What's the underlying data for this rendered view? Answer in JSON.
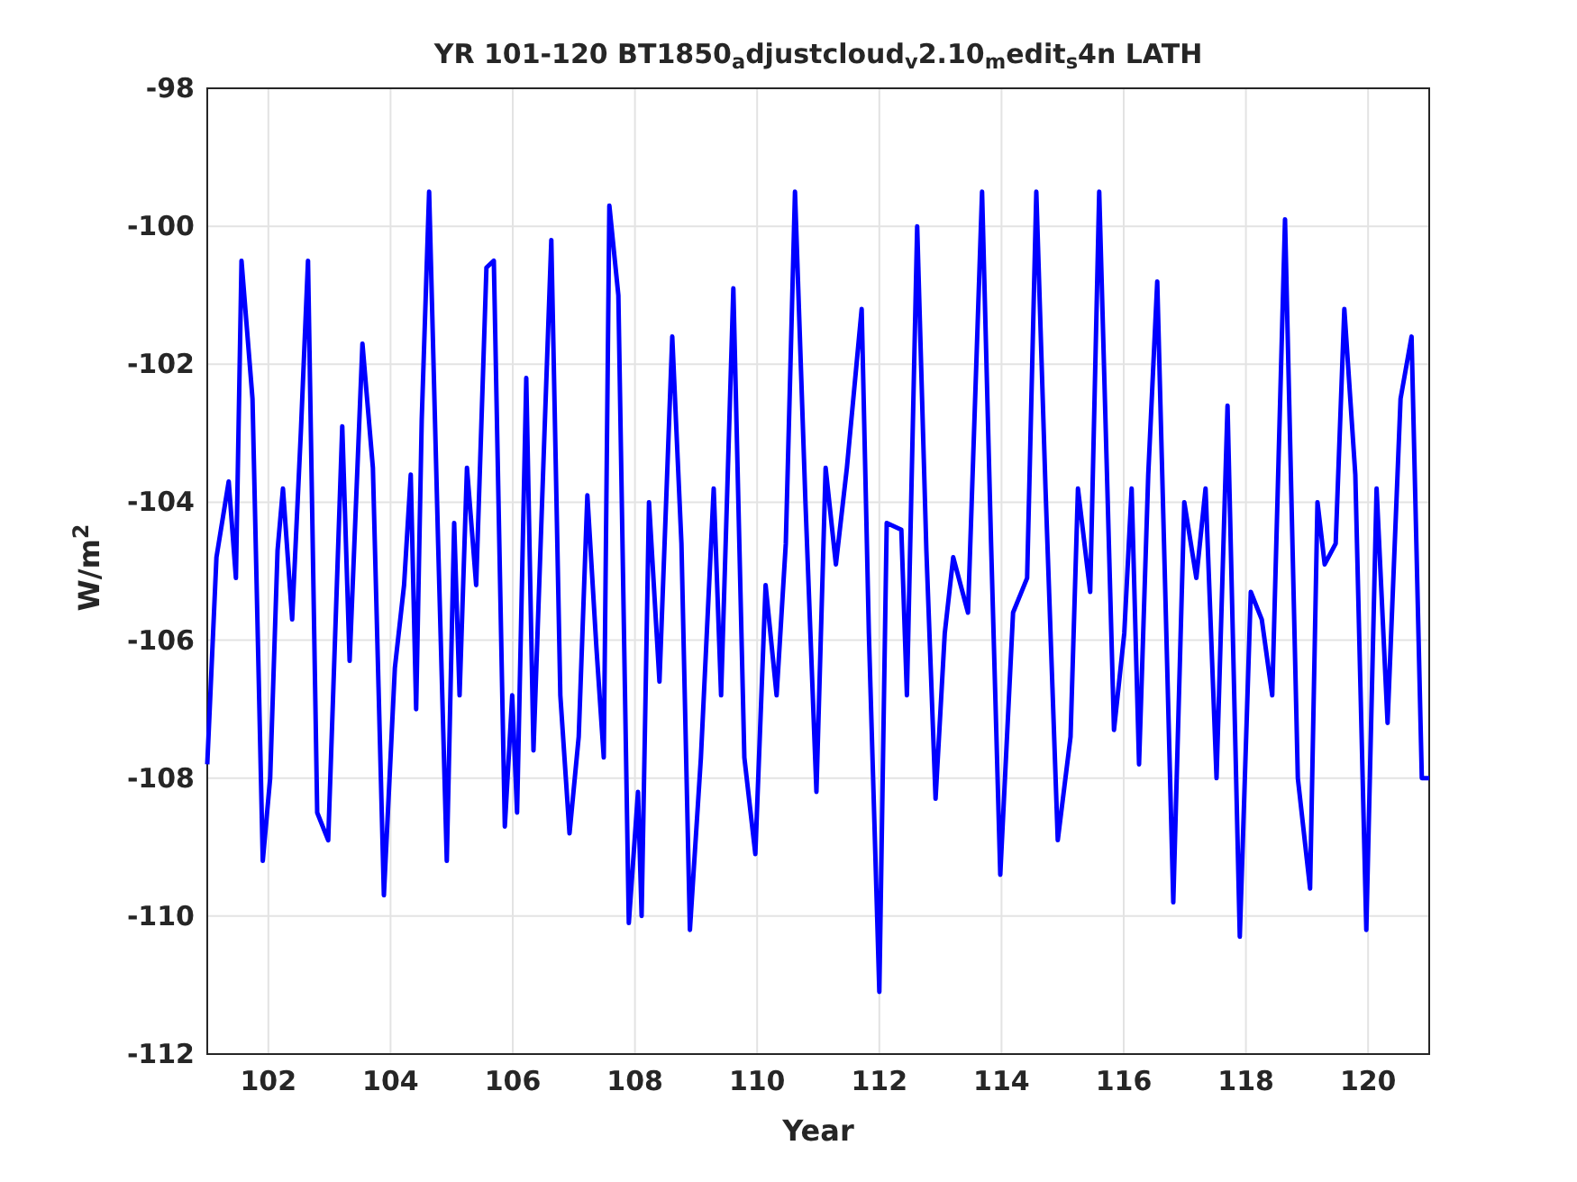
{
  "figure": {
    "chart_data": {
      "type": "line",
      "title": "YR 101-120 BT1850$_{a}$djustcloud$_{v}$2.10$_{m}$edit$_{s}$4n LATH",
      "xlabel": "Year",
      "ylabel": "W/m$^{2}$",
      "xlim": [
        101,
        121
      ],
      "ylim": [
        -112,
        -98
      ],
      "xticks": [
        102,
        104,
        106,
        108,
        110,
        112,
        114,
        116,
        118,
        120
      ],
      "yticks": [
        -112,
        -110,
        -108,
        -106,
        -104,
        -102,
        -100,
        -98
      ],
      "x": [
        101.0,
        101.15,
        101.35,
        101.47,
        101.56,
        101.74,
        101.91,
        102.03,
        102.15,
        102.24,
        102.39,
        102.53,
        102.65,
        102.8,
        102.98,
        103.21,
        103.33,
        103.54,
        103.71,
        103.89,
        104.07,
        104.22,
        104.33,
        104.42,
        104.51,
        104.63,
        104.78,
        104.92,
        105.04,
        105.13,
        105.25,
        105.4,
        105.57,
        105.69,
        105.87,
        105.99,
        106.07,
        106.22,
        106.34,
        106.52,
        106.63,
        106.78,
        106.93,
        107.08,
        107.22,
        107.37,
        107.49,
        107.58,
        107.73,
        107.9,
        108.05,
        108.11,
        108.23,
        108.4,
        108.61,
        108.76,
        108.9,
        109.08,
        109.29,
        109.41,
        109.61,
        109.79,
        109.97,
        110.14,
        110.32,
        110.47,
        110.62,
        110.79,
        110.97,
        111.12,
        111.29,
        111.47,
        111.71,
        111.83,
        112.0,
        112.12,
        112.36,
        112.45,
        112.62,
        112.77,
        112.92,
        113.07,
        113.21,
        113.45,
        113.68,
        113.83,
        113.98,
        114.19,
        114.42,
        114.57,
        114.72,
        114.92,
        115.13,
        115.25,
        115.45,
        115.6,
        115.84,
        116.01,
        116.13,
        116.25,
        116.4,
        116.55,
        116.81,
        116.99,
        117.19,
        117.34,
        117.52,
        117.7,
        117.9,
        118.08,
        118.26,
        118.43,
        118.64,
        118.85,
        119.05,
        119.17,
        119.29,
        119.47,
        119.61,
        119.79,
        119.97,
        120.14,
        120.32,
        120.53,
        120.71,
        120.88,
        121.0
      ],
      "grid": true,
      "series": [
        {
          "color": "#0000ff",
          "values": [
            -107.8,
            -104.8,
            -103.7,
            -105.1,
            -100.5,
            -102.5,
            -109.2,
            -108.0,
            -104.7,
            -103.8,
            -105.7,
            -103.0,
            -100.5,
            -108.5,
            -108.9,
            -102.9,
            -106.3,
            -101.7,
            -103.5,
            -109.7,
            -106.4,
            -105.2,
            -103.6,
            -107.0,
            -102.8,
            -99.5,
            -104.6,
            -109.2,
            -104.3,
            -106.8,
            -103.5,
            -105.2,
            -100.6,
            -100.5,
            -108.7,
            -106.8,
            -108.5,
            -102.2,
            -107.6,
            -103.0,
            -100.2,
            -106.8,
            -108.8,
            -107.4,
            -103.9,
            -106.1,
            -107.7,
            -99.7,
            -101.0,
            -110.1,
            -108.2,
            -110.0,
            -104.0,
            -106.6,
            -101.6,
            -104.6,
            -110.2,
            -107.7,
            -103.8,
            -106.8,
            -100.9,
            -107.7,
            -109.1,
            -105.2,
            -106.8,
            -104.6,
            -99.5,
            -104.0,
            -108.2,
            -103.5,
            -104.9,
            -103.5,
            -101.2,
            -105.9,
            -111.1,
            -104.3,
            -104.4,
            -106.8,
            -100.0,
            -104.7,
            -108.3,
            -105.9,
            -104.8,
            -105.6,
            -99.5,
            -104.6,
            -109.4,
            -105.6,
            -105.1,
            -99.5,
            -103.8,
            -108.9,
            -107.4,
            -103.8,
            -105.3,
            -99.5,
            -107.3,
            -105.9,
            -103.8,
            -107.8,
            -103.6,
            -100.8,
            -109.8,
            -104.0,
            -105.1,
            -103.8,
            -108.0,
            -102.6,
            -110.3,
            -105.3,
            -105.7,
            -106.8,
            -99.9,
            -108.0,
            -109.6,
            -104.0,
            -104.9,
            -104.6,
            -101.2,
            -103.6,
            -110.2,
            -103.8,
            -107.2,
            -102.5,
            -101.6,
            -108.0,
            -108.0
          ]
        }
      ]
    }
  }
}
